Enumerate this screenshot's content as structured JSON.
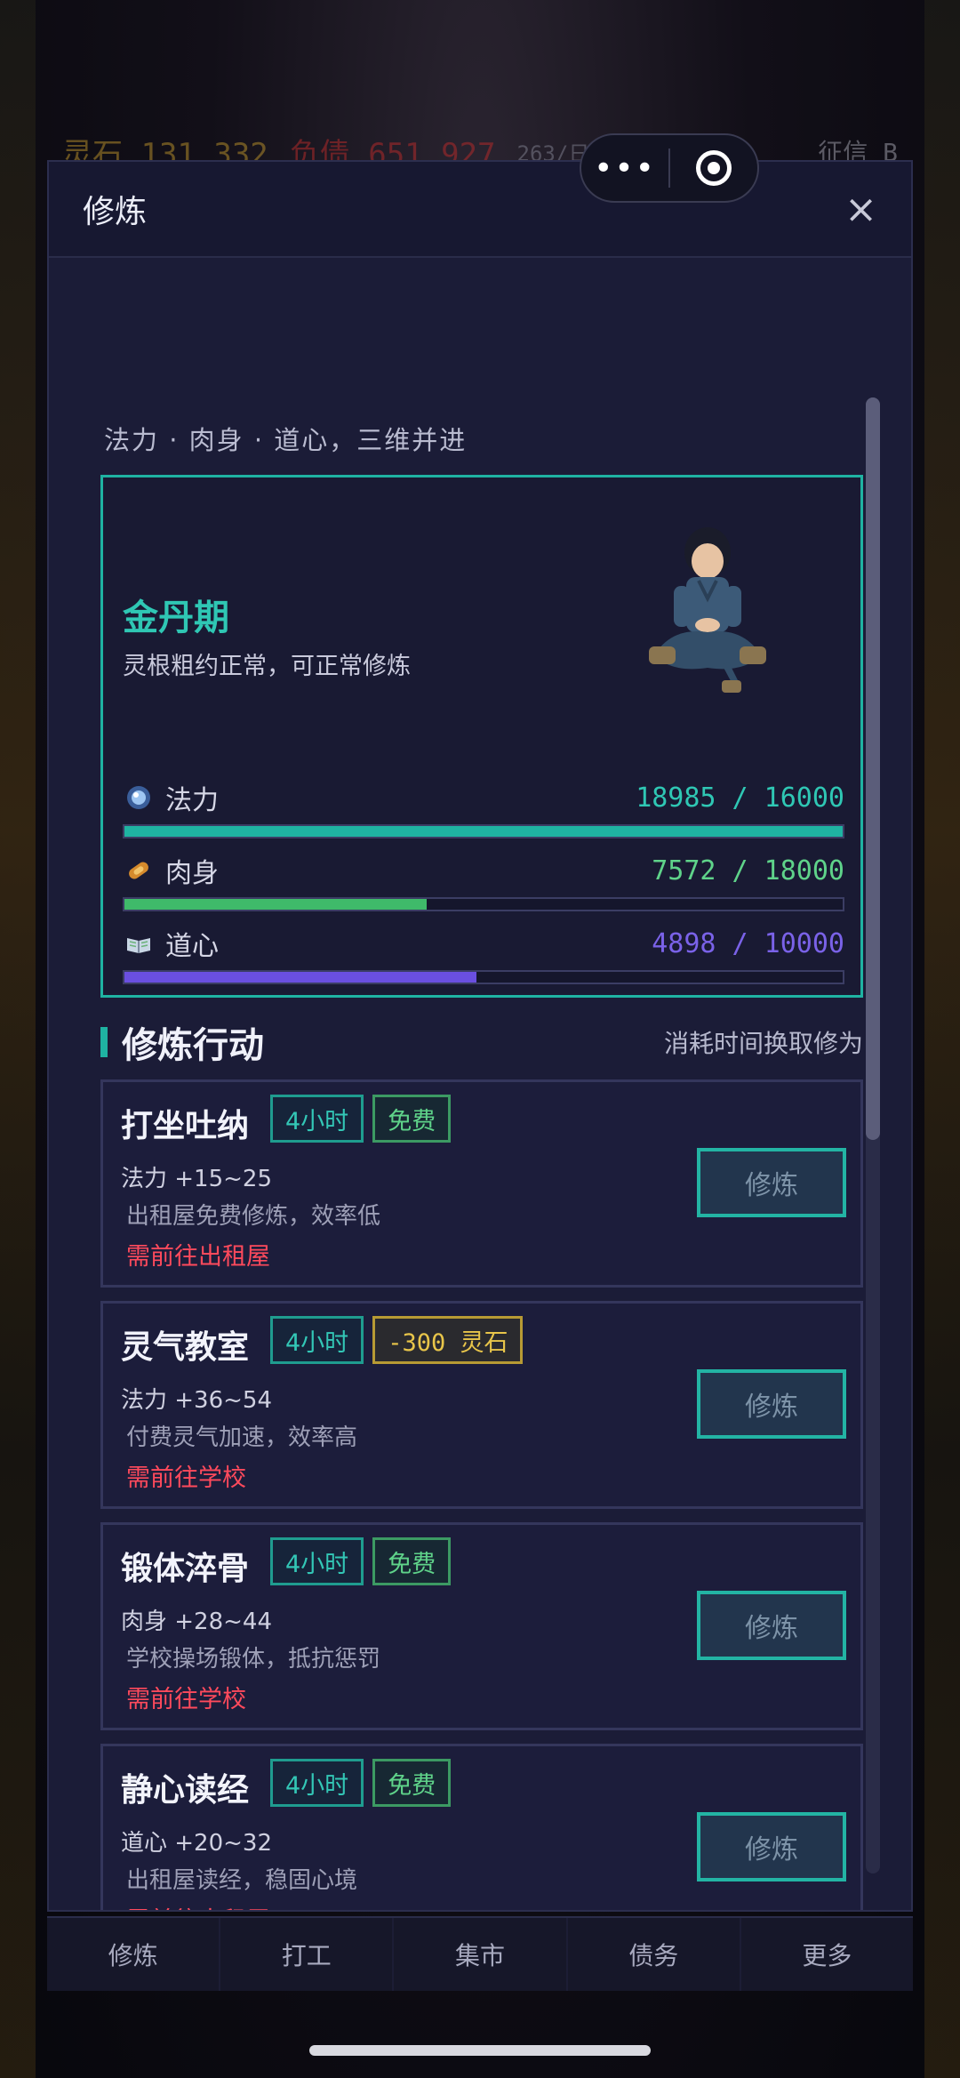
{
  "background_hud": {
    "stone": "灵石 131,332",
    "debt": "负债 651,927",
    "rate": "263/日",
    "credit": "征信 B"
  },
  "capsule": {
    "more": "•••"
  },
  "panel": {
    "title": "修炼",
    "close": "×",
    "subtitle": "法力 · 肉身 · 道心，三维并进"
  },
  "status": {
    "realm": "金丹期",
    "realm_desc": "灵根粗约正常，可正常修炼",
    "stats": [
      {
        "label": "法力",
        "value": "18985 / 16000",
        "fraction": 1.0,
        "color": "#1fb3a2"
      },
      {
        "label": "肉身",
        "value": "7572 / 18000",
        "fraction": 0.4207,
        "color": "#3fba6a"
      },
      {
        "label": "道心",
        "value": "4898 / 10000",
        "fraction": 0.4898,
        "color": "#6a4fe0"
      }
    ]
  },
  "section": {
    "title": "修炼行动",
    "note": "消耗时间换取修为"
  },
  "actions": [
    {
      "name": "打坐吐纳",
      "time": "4小时",
      "cost": "免费",
      "cost_type": "free",
      "effect": "法力 +15~25",
      "desc": "出租屋免费修炼，效率低",
      "req": "需前往出租屋",
      "button": "修炼"
    },
    {
      "name": "灵气教室",
      "time": "4小时",
      "cost": "-300 灵石",
      "cost_type": "paid",
      "effect": "法力 +36~54",
      "desc": "付费灵气加速，效率高",
      "req": "需前往学校",
      "button": "修炼"
    },
    {
      "name": "锻体淬骨",
      "time": "4小时",
      "cost": "免费",
      "cost_type": "free",
      "effect": "肉身 +28~44",
      "desc": "学校操场锻体，抵抗惩罚",
      "req": "需前往学校",
      "button": "修炼"
    },
    {
      "name": "静心读经",
      "time": "4小时",
      "cost": "免费",
      "cost_type": "free",
      "effect": "道心 +20~32",
      "desc": "出租屋读经，稳固心境",
      "req": "需前往出租屋",
      "button": "修炼"
    }
  ],
  "nav": [
    "修炼",
    "打工",
    "集市",
    "债务",
    "更多"
  ],
  "colors": {
    "accent": "#1fb3a2",
    "warning": "#ff4a5c",
    "gold": "#e8c54a"
  }
}
